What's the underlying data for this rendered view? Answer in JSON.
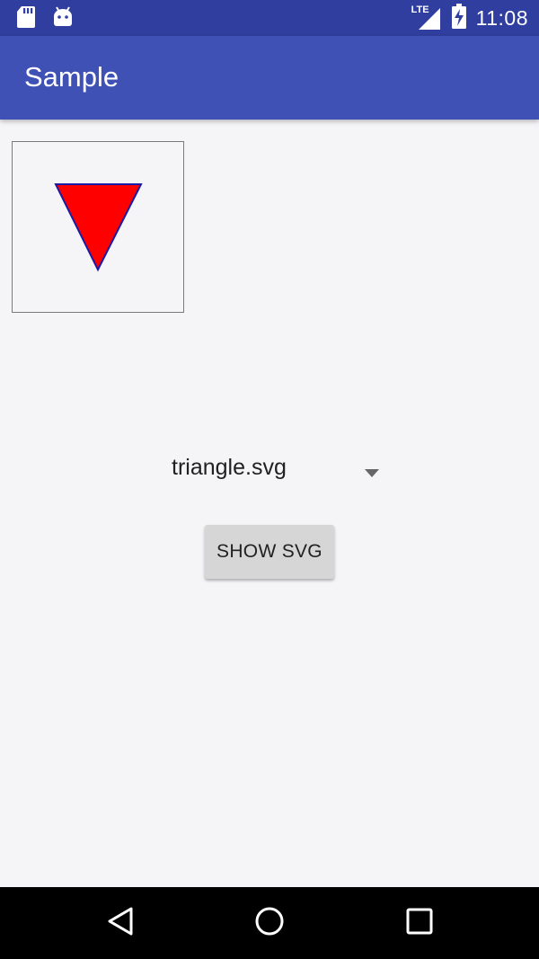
{
  "status_bar": {
    "time": "11:08",
    "network_label": "LTE",
    "icons": [
      "sd-card-icon",
      "android-icon",
      "lte-signal-icon",
      "battery-charging-icon"
    ]
  },
  "app_bar": {
    "title": "Sample"
  },
  "preview": {
    "shape": "triangle",
    "fill": "#ff0000",
    "stroke": "#1a1aa6"
  },
  "spinner": {
    "selected": "triangle.svg"
  },
  "actions": {
    "show_label": "SHOW SVG"
  },
  "nav_bar": {
    "buttons": [
      "back",
      "home",
      "recents"
    ]
  },
  "colors": {
    "status_bar": "#303f9f",
    "app_bar": "#3f51b5",
    "background": "#f5f4f7",
    "button": "#d6d6d6"
  }
}
